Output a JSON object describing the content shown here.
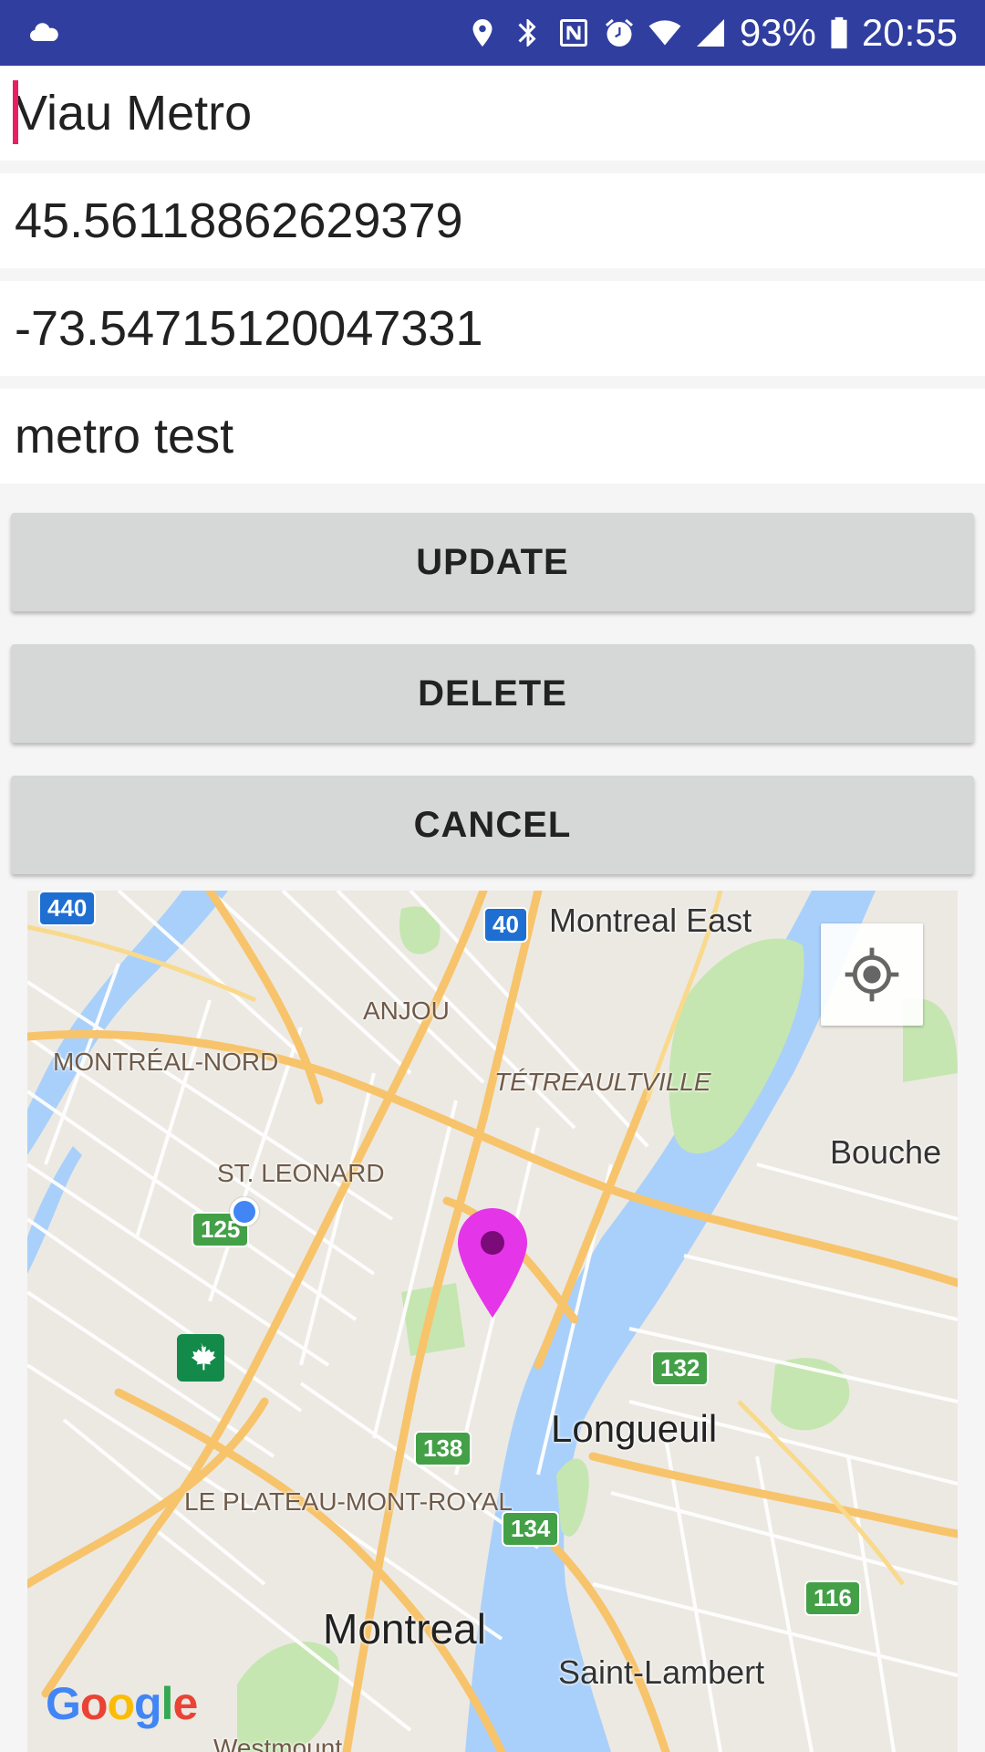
{
  "status_bar": {
    "battery": "93%",
    "time": "20:55",
    "icons": [
      "cloud-icon",
      "location-icon",
      "bluetooth-icon",
      "nfc-icon",
      "alarm-icon",
      "wifi-icon",
      "signal-icon",
      "battery-icon"
    ]
  },
  "form": {
    "name_value": "Viau Metro",
    "latitude_value": "45.56118862629379",
    "longitude_value": "-73.54715120047331",
    "description_value": "metro test"
  },
  "buttons": {
    "update": "UPDATE",
    "delete": "DELETE",
    "cancel": "CANCEL"
  },
  "map": {
    "labels": {
      "montreal_east": "Montreal East",
      "anjou": "ANJOU",
      "montreal_nord": "MONTRÉAL-NORD",
      "tetreaultville": "TÉTREAULTVILLE",
      "boucherville": "Bouche",
      "st_leonard": "ST. LEONARD",
      "longueuil": "Longueuil",
      "plateau": "LE PLATEAU-MONT-ROYAL",
      "montreal": "Montreal",
      "saint_lambert": "Saint-Lambert",
      "westmount": "Westmount"
    },
    "shields": {
      "r440": "440",
      "r40": "40",
      "r125": "125",
      "r132": "132",
      "r138": "138",
      "r134": "134",
      "r116": "116"
    },
    "logo": [
      "G",
      "o",
      "o",
      "g",
      "l",
      "e"
    ],
    "colors": {
      "pin": "#e535e8",
      "water": "#a9d0fa",
      "park": "#c5e6b0",
      "road_major": "#f7c46c"
    }
  }
}
